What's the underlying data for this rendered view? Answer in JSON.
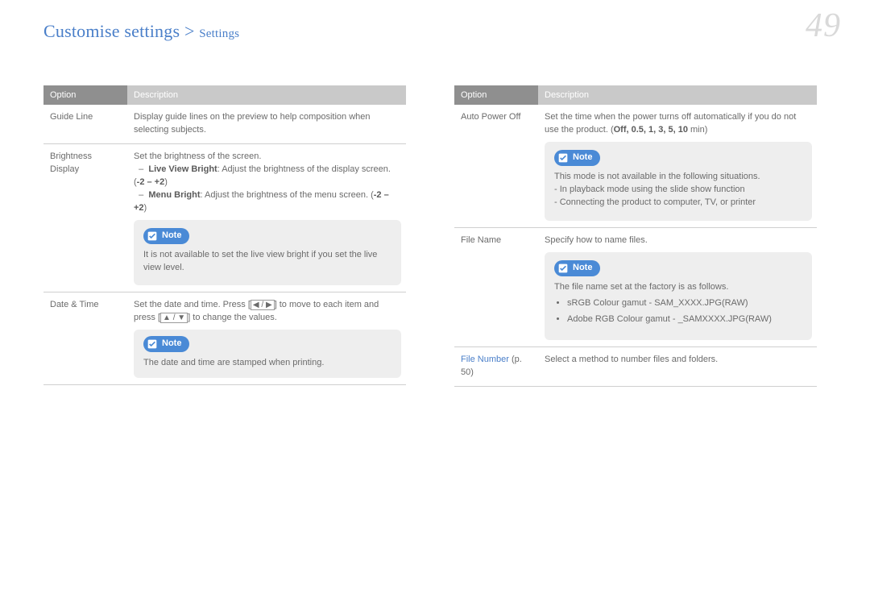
{
  "breadcrumb": {
    "main": "Customise settings",
    "sep": ">",
    "sub": "Settings"
  },
  "page_number": "49",
  "table_header": {
    "option": "Option",
    "description": "Description"
  },
  "left": {
    "r1": {
      "label": "Guide Line",
      "desc": "Display guide lines on the preview to help composition when selecting subjects."
    },
    "r2": {
      "label": "Brightness Display",
      "desc": "Set the brightness of the screen.",
      "b1": "Live View Bright",
      "b1d": ": Adjust the brightness of the display screen. (",
      "rng1": "-2 – +2",
      "tail1": ")",
      "b2": "Menu Bright",
      "b2d": ": Adjust the brightness of the menu screen. (",
      "rng2": "-2 – +2",
      "tail2": ")",
      "note_label": "Note",
      "note": "It is not available to set the live view bright if you set the live view level."
    },
    "r3": {
      "label": "Date & Time",
      "desc1": "Set the date and time. Press [",
      "boxed1": "◀ / ▶",
      "desc2": "] to move to each item and press [",
      "boxed2": "▲ / ▼",
      "desc3": "] to change the values.",
      "note_label": "Note",
      "note": "The date and time are stamped when printing."
    }
  },
  "right": {
    "r1": {
      "label": "Auto Power Off",
      "desc": "Set the time when the power turns off automatically if you do not use the product. (",
      "opts": "Off, 0.5, 1, 3, 5, 10",
      "tail": "  min)",
      "note_label": "Note",
      "note_l1": "This mode is not available in the following situations.",
      "note_l2": "- In playback mode using the slide show function",
      "note_l3": "- Connecting the product to computer, TV, or printer"
    },
    "r2": {
      "label": "File Name",
      "desc": "Specify how to name files.",
      "note_label": "Note",
      "note_lead": "The file name set at the factory is as follows.",
      "note_b1": "sRGB Colour gamut - SAM_XXXX.JPG(RAW)",
      "note_b2": "Adobe RGB Colour gamut - _SAMXXXX.JPG(RAW)"
    },
    "r3": {
      "label_link": "File Number",
      "label_rest": " (p. 50)",
      "desc": "Select a method to number files and folders."
    }
  }
}
